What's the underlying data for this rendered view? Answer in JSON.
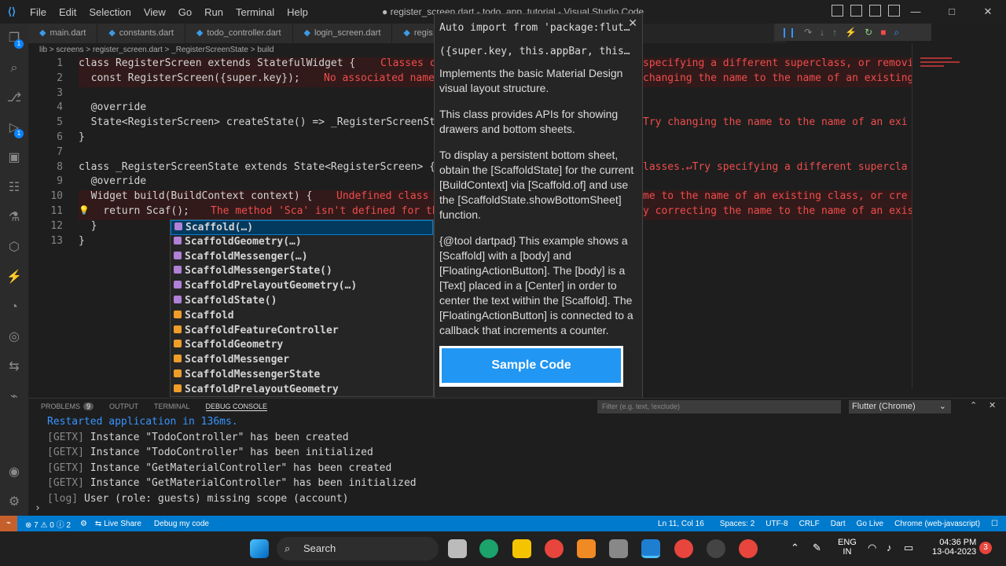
{
  "window": {
    "title": "● register_screen.dart - todo_app_tutorial - Visual Studio Code",
    "menu": [
      "File",
      "Edit",
      "Selection",
      "View",
      "Go",
      "Run",
      "Terminal",
      "Help"
    ]
  },
  "tabs": [
    "main.dart",
    "constants.dart",
    "todo_controller.dart",
    "login_screen.dart",
    "regis"
  ],
  "breadcrumb": "lib > screens > register_screen.dart > _RegisterScreenState > build",
  "code": {
    "lines": [
      {
        "n": "1",
        "text": "class RegisterScreen extends StatefulWidget {",
        "err": "Classes ca"
      },
      {
        "n": "2",
        "text": "  const RegisterScreen({super.key});",
        "err": "No associated named"
      },
      {
        "n": "3",
        "text": "",
        "err": ""
      },
      {
        "n": "4",
        "text": "  @override",
        "err": ""
      },
      {
        "n": "5",
        "text": "  State<RegisterScreen> createState() => _RegisterScreenSta",
        "err": ""
      },
      {
        "n": "6",
        "text": "}",
        "err": ""
      },
      {
        "n": "7",
        "text": "",
        "err": ""
      },
      {
        "n": "8",
        "text": "class _RegisterScreenState extends State<RegisterScreen> {",
        "err": ""
      },
      {
        "n": "9",
        "text": "  @override",
        "err": ""
      },
      {
        "n": "10",
        "text": "  Widget build(BuildContext context) {",
        "err": "Undefined class"
      },
      {
        "n": "11",
        "text": "    return Scaf();",
        "err": "The method 'Sca' isn't defined for th"
      },
      {
        "n": "12",
        "text": "  }",
        "err": ""
      },
      {
        "n": "13",
        "text": "}",
        "err": ""
      }
    ],
    "right_errors": [
      {
        "line": 1,
        "text": "specifying a different superclass, or removin"
      },
      {
        "line": 2,
        "text": "changing the name to the name of an existing"
      },
      {
        "line": 5,
        "text": "Try changing the name to the name of an exi"
      },
      {
        "line": 8,
        "text": "lasses.↵Try specifying a different supercla"
      },
      {
        "line": 10,
        "text": "me to the name of an existing class, or cre"
      },
      {
        "line": 11,
        "text": "y correcting the name to the name of an exis"
      }
    ]
  },
  "suggestions": [
    {
      "label": "Scaffold(…)",
      "kind": "method"
    },
    {
      "label": "ScaffoldGeometry(…)",
      "kind": "method"
    },
    {
      "label": "ScaffoldMessenger(…)",
      "kind": "method"
    },
    {
      "label": "ScaffoldMessengerState()",
      "kind": "method"
    },
    {
      "label": "ScaffoldPrelayoutGeometry(…)",
      "kind": "method"
    },
    {
      "label": "ScaffoldState()",
      "kind": "method"
    },
    {
      "label": "Scaffold",
      "kind": "class"
    },
    {
      "label": "ScaffoldFeatureController",
      "kind": "class"
    },
    {
      "label": "ScaffoldGeometry",
      "kind": "class"
    },
    {
      "label": "ScaffoldMessenger",
      "kind": "class"
    },
    {
      "label": "ScaffoldMessengerState",
      "kind": "class"
    },
    {
      "label": "ScaffoldPrelayoutGeometry",
      "kind": "class"
    }
  ],
  "doc": {
    "header1": "Auto import from 'package:flut…",
    "header2": "({super.key, this.appBar, this…",
    "p1": "Implements the basic Material Design visual layout structure.",
    "p2": "This class provides APIs for showing drawers and bottom sheets.",
    "p3": "To display a persistent bottom sheet, obtain the [ScaffoldState] for the current [BuildContext] via [Scaffold.of] and use the [ScaffoldState.showBottomSheet] function.",
    "p4": "{@tool dartpad} This example shows a [Scaffold] with a [body] and [FloatingActionButton]. The [body] is a [Text] placed in a [Center] in order to center the text within the [Scaffold]. The [FloatingActionButton] is connected to a callback that increments a counter.",
    "sample": "Sample Code"
  },
  "panel": {
    "tabs": [
      "PROBLEMS",
      "OUTPUT",
      "TERMINAL",
      "DEBUG CONSOLE"
    ],
    "problems_count": "9",
    "filter_placeholder": "Filter (e.g. text, !exclude)",
    "session": "Flutter (Chrome)",
    "lines": [
      {
        "tag": "",
        "text": "Restarted application in 136ms."
      },
      {
        "tag": "[GETX]",
        "text": " Instance \"TodoController\" has been created"
      },
      {
        "tag": "[GETX]",
        "text": " Instance \"TodoController\" has been initialized"
      },
      {
        "tag": "[GETX]",
        "text": " Instance \"GetMaterialController\" has been created"
      },
      {
        "tag": "[GETX]",
        "text": " Instance \"GetMaterialController\" has been initialized"
      },
      {
        "tag": "[log]",
        "text": " User (role: guests) missing scope (account)"
      }
    ]
  },
  "status": {
    "errors": "7",
    "warnings": "0",
    "info": "2",
    "liveshare": "Live Share",
    "debug": "Debug my code",
    "position": "Ln 11, Col 16",
    "spaces": "Spaces: 2",
    "encoding": "UTF-8",
    "eol": "CRLF",
    "lang": "Dart",
    "golive": "Go Live",
    "device": "Chrome (web-javascript)"
  },
  "taskbar": {
    "search": "Search",
    "lang": "ENG",
    "region": "IN",
    "time": "04:36 PM",
    "date": "13-04-2023",
    "notif": "3"
  },
  "colors": {
    "accent": "#007acc",
    "error": "#f14c4c",
    "suggest_sel": "#04395e"
  }
}
